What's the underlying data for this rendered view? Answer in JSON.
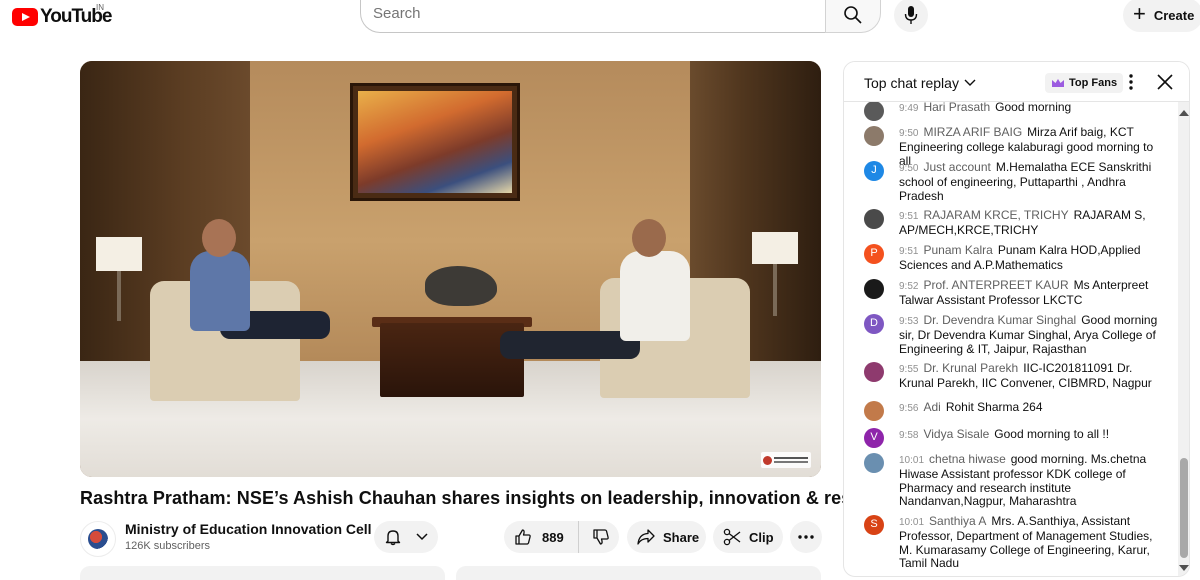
{
  "header": {
    "logo_text": "YouTube",
    "region": "IN",
    "search_placeholder": "Search",
    "create_label": "Create"
  },
  "video": {
    "title": "Rashtra Pratham: NSE’s Ashish Chauhan shares insights on leadership, innovation & resilience.",
    "channel_name": "Ministry of Education Innovation Cell",
    "subscribers": "126K subscribers",
    "like_count": "889",
    "share_label": "Share",
    "clip_label": "Clip"
  },
  "chat": {
    "title": "Top chat replay",
    "top_fans_label": "Top Fans",
    "messages": [
      {
        "time": "9:49",
        "author": "Hari Prasath",
        "text": "Good morning",
        "avatar_letter": "",
        "avatar_color": "#5a5a5a"
      },
      {
        "time": "9:50",
        "author": "MIRZA ARIF BAIG",
        "text": "Mirza Arif baig, KCT Engineering college kalaburagi good morning to all",
        "avatar_letter": "",
        "avatar_color": "#8c7a6a"
      },
      {
        "time": "9:50",
        "author": "Just account",
        "text": "M.Hemalatha ECE Sanskrithi school of engineering, Puttaparthi , Andhra Pradesh",
        "avatar_letter": "J",
        "avatar_color": "#1e88e5"
      },
      {
        "time": "9:51",
        "author": "RAJARAM KRCE, TRICHY",
        "text": "RAJARAM S, AP/MECH,KRCE,TRICHY",
        "avatar_letter": "",
        "avatar_color": "#4a4a4a"
      },
      {
        "time": "9:51",
        "author": "Punam Kalra",
        "text": "Punam Kalra HOD,Applied Sciences and A.P.Mathematics",
        "avatar_letter": "P",
        "avatar_color": "#f4511e"
      },
      {
        "time": "9:52",
        "author": "Prof. ANTERPREET KAUR",
        "text": "Ms Anterpreet Talwar Assistant Professor LKCTC",
        "avatar_letter": "",
        "avatar_color": "#1a1a1a"
      },
      {
        "time": "9:53",
        "author": "Dr. Devendra Kumar Singhal",
        "text": "Good morning sir, Dr Devendra Kumar Singhal, Arya College of Engineering & IT, Jaipur, Rajasthan",
        "avatar_letter": "D",
        "avatar_color": "#7e57c2"
      },
      {
        "time": "9:55",
        "author": "Dr. Krunal Parekh",
        "text": "IIC-IC201811091 Dr. Krunal Parekh, IIC Convener, CIBMRD, Nagpur",
        "avatar_letter": "",
        "avatar_color": "#8e3a6e"
      },
      {
        "time": "9:56",
        "author": "Adi",
        "text": "Rohit Sharma 264",
        "avatar_letter": "",
        "avatar_color": "#c27a4a"
      },
      {
        "time": "9:58",
        "author": "Vidya Sisale",
        "text": "Good morning to all !!",
        "avatar_letter": "V",
        "avatar_color": "#8e24aa"
      },
      {
        "time": "10:01",
        "author": "chetna hiwase",
        "text": "good morning. Ms.chetna Hiwase Assistant professor KDK college of Pharmacy and research institute Nandanvan,Nagpur, Maharashtra",
        "avatar_letter": "",
        "avatar_color": "#6a8fb0"
      },
      {
        "time": "10:01",
        "author": "Santhiya A",
        "text": "Mrs. A.Santhiya, Assistant Professor, Department of Management Studies, M. Kumarasamy College of Engineering, Karur, Tamil Nadu",
        "avatar_letter": "S",
        "avatar_color": "#d84315"
      }
    ]
  }
}
